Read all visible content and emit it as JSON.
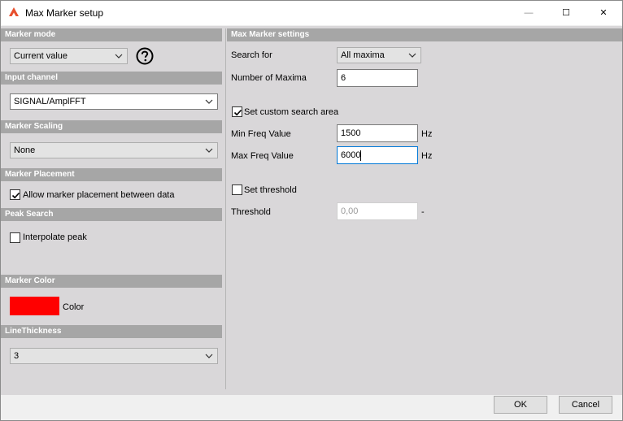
{
  "window": {
    "title": "Max Marker setup",
    "minimize_glyph": "—",
    "maximize_glyph": "☐",
    "close_glyph": "✕",
    "app_icon": "dewesoft-logo-icon",
    "app_icon_color": "#e8502e"
  },
  "left": {
    "marker_mode": {
      "header": "Marker mode",
      "value": "Current value",
      "help_icon": "question-circle-icon"
    },
    "input_channel": {
      "header": "Input channel",
      "value": "SIGNAL/AmplFFT"
    },
    "marker_scaling": {
      "header": "Marker Scaling",
      "value": "None"
    },
    "marker_placement": {
      "header": "Marker Placement",
      "checkbox_label": "Allow marker placement between data",
      "checked": true
    },
    "peak_search": {
      "header": "Peak Search",
      "checkbox_label": "Interpolate peak",
      "checked": false
    },
    "marker_color": {
      "header": "Marker Color",
      "label": "Color",
      "color": "#ff0000"
    },
    "line_thickness": {
      "header": "LineThickness",
      "value": "3"
    }
  },
  "right": {
    "header": "Max Marker settings",
    "search_for": {
      "label": "Search for",
      "value": "All maxima"
    },
    "number_of_maxima": {
      "label": "Number of Maxima",
      "value": "6"
    },
    "custom_area": {
      "label": "Set custom search area",
      "checked": true
    },
    "min_freq": {
      "label": "Min Freq Value",
      "value": "1500",
      "unit": "Hz"
    },
    "max_freq": {
      "label": "Max Freq Value",
      "value": "6000",
      "unit": "Hz"
    },
    "threshold_toggle": {
      "label": "Set threshold",
      "checked": false
    },
    "threshold": {
      "label": "Threshold",
      "value": "0,00",
      "unit": "-"
    }
  },
  "footer": {
    "ok_label": "OK",
    "cancel_label": "Cancel"
  },
  "colors": {
    "section_header": "#a6a6a6",
    "panel_bg": "#d9d7d9",
    "focus_border": "#0078d7"
  }
}
